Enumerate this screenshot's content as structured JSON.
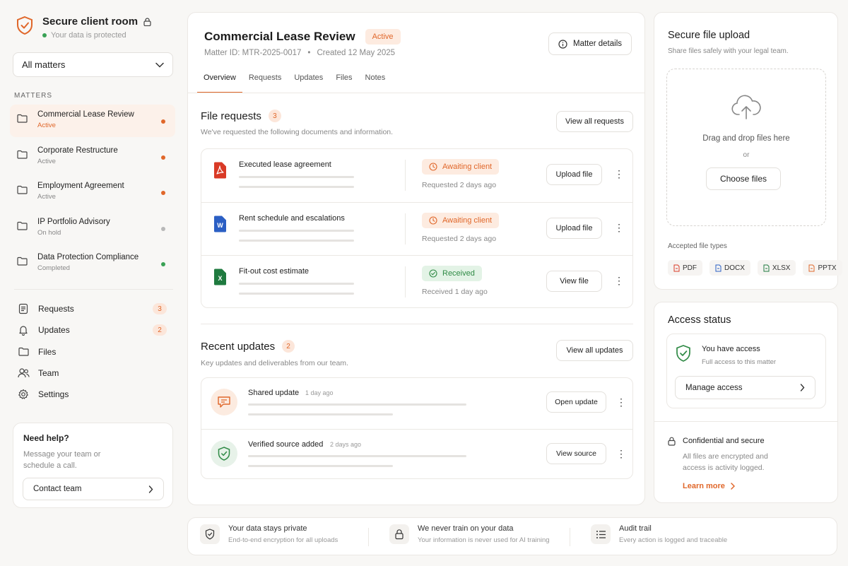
{
  "brand": {
    "title": "Secure client room",
    "subtitle": "Your data is protected"
  },
  "matter_select": {
    "value": "All matters"
  },
  "matters_label": "MATTERS",
  "matters": [
    {
      "name": "Commercial Lease Review",
      "status": "Active",
      "dot_color": "#e0672a"
    },
    {
      "name": "Corporate Restructure",
      "status": "Active",
      "dot_color": "#e0672a"
    },
    {
      "name": "Employment Agreement",
      "status": "Active",
      "dot_color": "#e0672a"
    },
    {
      "name": "IP Portfolio Advisory",
      "status": "On hold",
      "dot_color": "#b8b8b8"
    },
    {
      "name": "Data Protection Compliance",
      "status": "Completed",
      "dot_color": "#3aa155"
    }
  ],
  "nav": [
    {
      "label": "Requests",
      "icon": "document-icon",
      "badge": "3"
    },
    {
      "label": "Updates",
      "icon": "bell-icon",
      "badge": "2"
    },
    {
      "label": "Files",
      "icon": "folder-icon",
      "badge": ""
    },
    {
      "label": "Team",
      "icon": "users-icon",
      "badge": ""
    },
    {
      "label": "Settings",
      "icon": "gear-icon",
      "badge": ""
    }
  ],
  "help": {
    "title": "Need help?",
    "text": "Message your team or schedule a call.",
    "button": "Contact team"
  },
  "matter": {
    "title": "Commercial Lease Review",
    "status": "Active",
    "matter_id": "Matter ID: MTR-2025-0017",
    "created": "Created 12 May 2025",
    "details_button": "Matter details"
  },
  "tabs": [
    "Overview",
    "Requests",
    "Updates",
    "Files",
    "Notes"
  ],
  "file_requests": {
    "title": "File requests",
    "count": "3",
    "description": "We've requested the following documents and information.",
    "view_all": "View all requests",
    "items": [
      {
        "name": "Executed lease agreement",
        "file_type": "PDF",
        "status": "Awaiting client",
        "status_kind": "awaiting",
        "time": "Requested 2 days ago",
        "action": "Upload file"
      },
      {
        "name": "Rent schedule and escalations",
        "file_type": "W",
        "status": "Awaiting client",
        "status_kind": "awaiting",
        "time": "Requested 2 days ago",
        "action": "Upload file"
      },
      {
        "name": "Fit-out cost estimate",
        "file_type": "X",
        "status": "Received",
        "status_kind": "received",
        "time": "Received 1 day ago",
        "action": "View file"
      }
    ]
  },
  "recent_updates": {
    "title": "Recent updates",
    "count": "2",
    "description": "Key updates and deliverables from our team.",
    "view_all": "View all updates",
    "items": [
      {
        "name": "Shared update",
        "time": "1 day ago",
        "action": "Open update",
        "icon": "message-icon"
      },
      {
        "name": "Verified source added",
        "time": "2 days ago",
        "action": "View source",
        "icon": "shield-check-icon"
      }
    ]
  },
  "upload": {
    "title": "Secure file upload",
    "subtitle": "Share files safely with your legal team.",
    "drop_text": "Drag and drop files here",
    "or": "or",
    "choose": "Choose files",
    "accepted_label": "Accepted file types",
    "types": [
      "PDF",
      "DOCX",
      "XLSX",
      "PPTX"
    ]
  },
  "access": {
    "title": "Access status",
    "status": "You have access",
    "detail": "Full access to this matter",
    "manage": "Manage access",
    "secure_title": "Confidential and secure",
    "secure_text": "All files are encrypted and access is activity logged.",
    "learn_more": "Learn more"
  },
  "footer": [
    {
      "title": "Your data stays private",
      "sub": "End-to-end encryption for all uploads",
      "icon": "shield-icon"
    },
    {
      "title": "We never train on your data",
      "sub": "Your information is never used for AI training",
      "icon": "lock-icon"
    },
    {
      "title": "Audit trail",
      "sub": "Every action is logged and traceable",
      "icon": "list-icon"
    }
  ],
  "colors": {
    "accent": "#e0672a",
    "success": "#3aa155",
    "word": "#2b5fc4",
    "excel": "#1f7a3f",
    "pdf": "#d93a26"
  }
}
